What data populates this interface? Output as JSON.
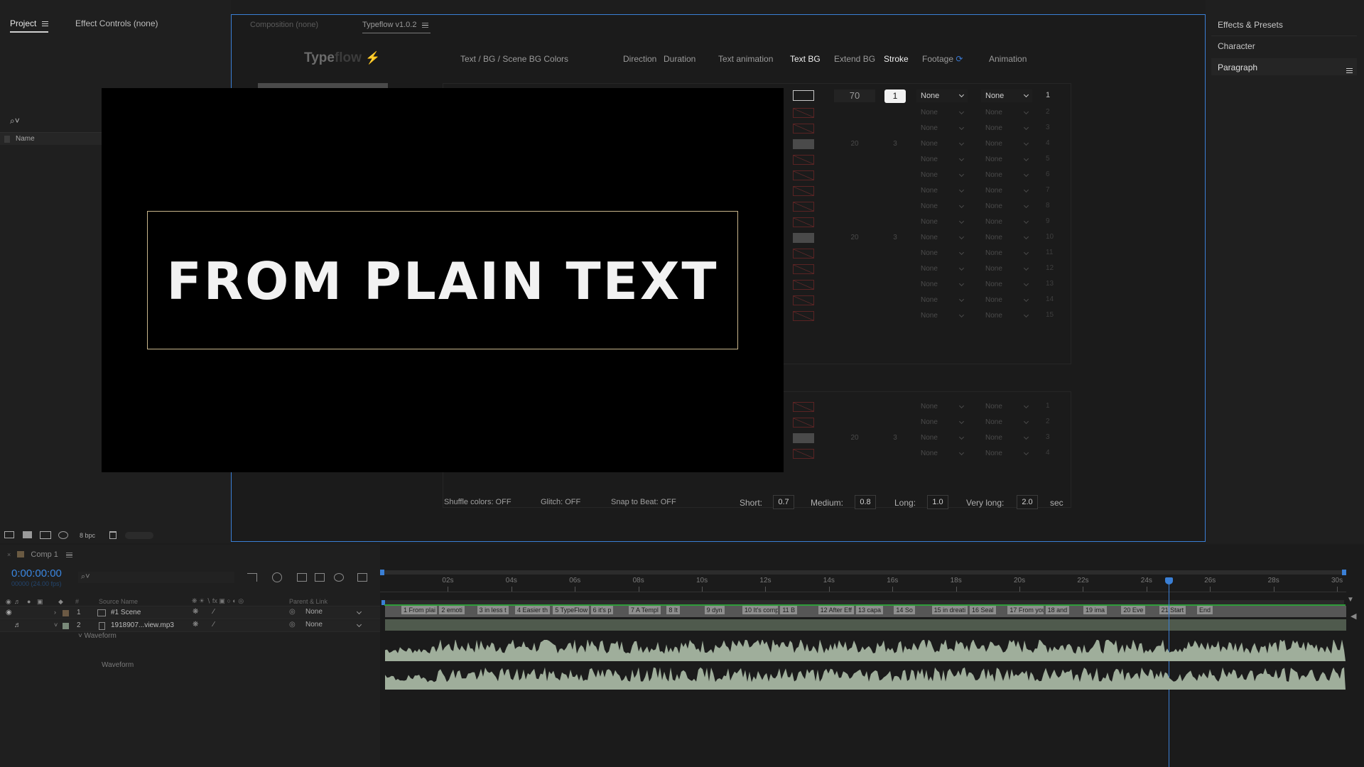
{
  "project_panel": {
    "tabs": [
      "Project",
      "Effect Controls (none)"
    ],
    "column_name": "Name",
    "bpc": "8 bpc"
  },
  "typeflow_panel": {
    "tabs": [
      "Composition (none)",
      "Typeflow v1.0.2"
    ],
    "logo": {
      "a": "Type",
      "b": "flow"
    },
    "headers": [
      "Text / BG / Scene BG Colors",
      "Direction",
      "Duration",
      "Text animation",
      "Text BG",
      "Extend BG",
      "Stroke",
      "Footage",
      "Animation"
    ],
    "row1": {
      "extend": "70",
      "stroke": "1",
      "footage": "None",
      "animation": "None",
      "index": "1"
    },
    "rows_main": [
      {
        "n": "2",
        "a": "None",
        "b": "None"
      },
      {
        "n": "3",
        "a": "None",
        "b": "None"
      },
      {
        "n": "4",
        "a": "None",
        "b": "None",
        "extend": "20",
        "stroke": "3"
      },
      {
        "n": "5",
        "a": "None",
        "b": "None"
      },
      {
        "n": "6",
        "a": "None",
        "b": "None"
      },
      {
        "n": "7",
        "a": "None",
        "b": "None"
      },
      {
        "n": "8",
        "a": "None",
        "b": "None"
      },
      {
        "n": "9",
        "a": "None",
        "b": "None"
      },
      {
        "n": "10",
        "a": "None",
        "b": "None",
        "extend": "20",
        "stroke": "3"
      },
      {
        "n": "11",
        "a": "None",
        "b": "None"
      },
      {
        "n": "12",
        "a": "None",
        "b": "None"
      },
      {
        "n": "13",
        "a": "None",
        "b": "None"
      },
      {
        "n": "14",
        "a": "None",
        "b": "None"
      },
      {
        "n": "15",
        "a": "None",
        "b": "None"
      }
    ],
    "rows_lower": [
      {
        "n": "1",
        "a": "None",
        "b": "None"
      },
      {
        "n": "2",
        "a": "None",
        "b": "None"
      },
      {
        "n": "3",
        "a": "None",
        "b": "None",
        "extend": "20",
        "stroke": "3"
      },
      {
        "n": "4",
        "a": "None",
        "b": "None"
      }
    ],
    "options": {
      "shuffle": "Shuffle colors: OFF",
      "glitch": "Glitch: OFF",
      "snap": "Snap to Beat: OFF",
      "short_label": "Short:",
      "short": "0.7",
      "medium_label": "Medium:",
      "medium": "0.8",
      "long_label": "Long:",
      "long": "1.0",
      "vlong_label": "Very long:",
      "vlong": "2.0",
      "unit": "sec"
    }
  },
  "viewer": {
    "text": "FROM PLAIN TEXT"
  },
  "right_panel": {
    "items": [
      "Effects & Presets",
      "Character",
      "Paragraph"
    ]
  },
  "timeline": {
    "comp_tab": "Comp 1",
    "timecode": "0:00:00:00",
    "timecode_sub": "00000 (24.00 fps)",
    "columns": {
      "source": "Source Name",
      "parent": "Parent & Link"
    },
    "layers": [
      {
        "num": "1",
        "name": "#1 Scene",
        "parent": "None"
      },
      {
        "num": "2",
        "name": "1918907...view.mp3",
        "parent": "None"
      }
    ],
    "waveform_group": "Waveform",
    "waveform_label": "Waveform",
    "ruler": [
      "02s",
      "04s",
      "06s",
      "08s",
      "10s",
      "12s",
      "14s",
      "16s",
      "18s",
      "20s",
      "22s",
      "24s",
      "26s",
      "28s",
      "30s"
    ],
    "markers": [
      "1 From plai",
      "2 emoti",
      "3 in less t",
      "4 Easier th",
      "5 TypeFlow",
      "6 it's p",
      "7 A Templ",
      "8 It",
      "9 dyn",
      "10 It's comp",
      "11 B",
      "12 After Eff",
      "13 capa",
      "14 So",
      "15 in dreati",
      "16 Seal",
      "17 From your",
      "18 and",
      "19 ima",
      "20 Eve",
      "21 Start",
      "End"
    ],
    "playhead_seconds": 24.7
  }
}
